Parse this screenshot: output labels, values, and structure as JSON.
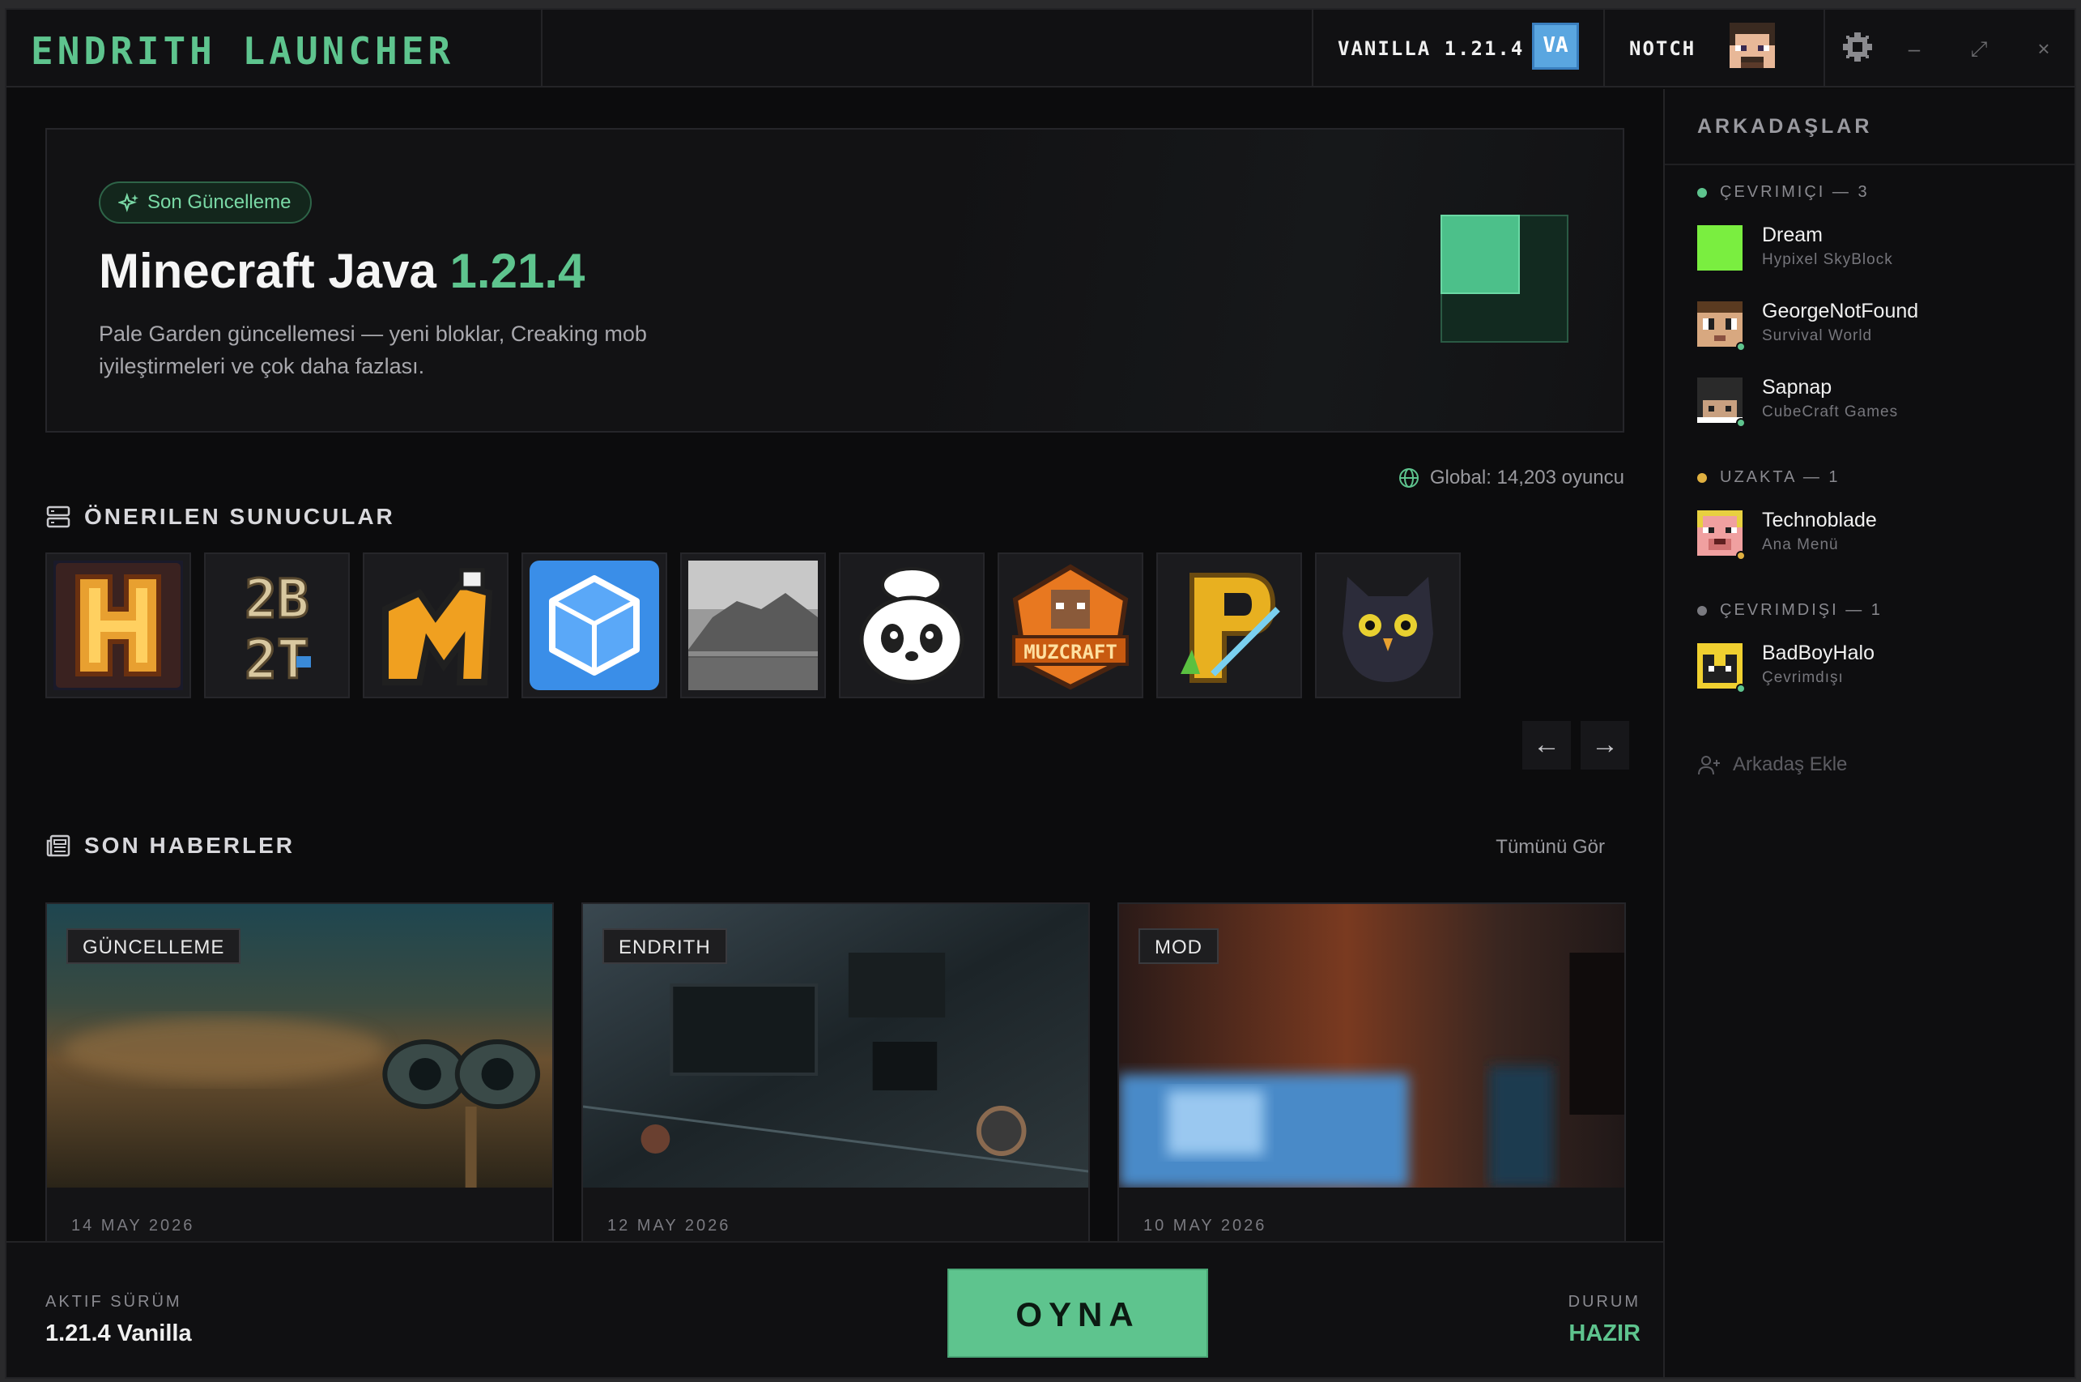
{
  "app": {
    "brand": "ENDRITH LAUNCHER",
    "version_label": "VANILLA 1.21.4",
    "version_badge": "VA",
    "username": "NOTCH",
    "controls": {
      "minimize": "–",
      "maximize": "⤢",
      "close": "×"
    }
  },
  "hero": {
    "pill": "Son Güncelleme",
    "title_prefix": "Minecraft Java",
    "title_version": "1.21.4",
    "description": "Pale Garden güncellemesi — yeni bloklar, Creaking mob iyileştirmeleri ve çok daha fazlası."
  },
  "servers": {
    "heading": "ÖNERILEN SUNUCULAR",
    "global": "Global: 14,203 oyuncu",
    "items": [
      "hypixel",
      "2b2t",
      "mineplex",
      "cubecraft",
      "landscape",
      "panda",
      "muzcraft",
      "pvp",
      "owl"
    ],
    "prev": "←",
    "next": "→"
  },
  "news": {
    "heading": "SON HABERLER",
    "see_all": "Tümünü Gör",
    "cards": [
      {
        "tag": "GÜNCELLEME",
        "date": "14 MAY 2026"
      },
      {
        "tag": "ENDRITH",
        "date": "12 MAY 2026"
      },
      {
        "tag": "MOD",
        "date": "10 MAY 2026"
      }
    ]
  },
  "footer": {
    "active_label": "AKTIF SÜRÜM",
    "active_value": "1.21.4 Vanilla",
    "play": "OYNA",
    "status_label": "DURUM",
    "status_value": "HAZIR"
  },
  "friends": {
    "title": "ARKADAŞLAR",
    "online_label": "ÇEVRIMIÇI — 3",
    "away_label": "UZAKTA — 1",
    "offline_label": "ÇEVRIMDIŞI — 1",
    "online": [
      {
        "name": "Dream",
        "status": "Hypixel SkyBlock"
      },
      {
        "name": "GeorgeNotFound",
        "status": "Survival World"
      },
      {
        "name": "Sapnap",
        "status": "CubeCraft Games"
      }
    ],
    "away": [
      {
        "name": "Technoblade",
        "status": "Ana Menü"
      }
    ],
    "offline": [
      {
        "name": "BadBoyHalo",
        "status": "Çevrimdışı"
      }
    ],
    "add": "Arkadaş Ekle"
  },
  "colors": {
    "accent": "#5ec48e",
    "away": "#e0b040",
    "offline": "#7a7a80"
  }
}
